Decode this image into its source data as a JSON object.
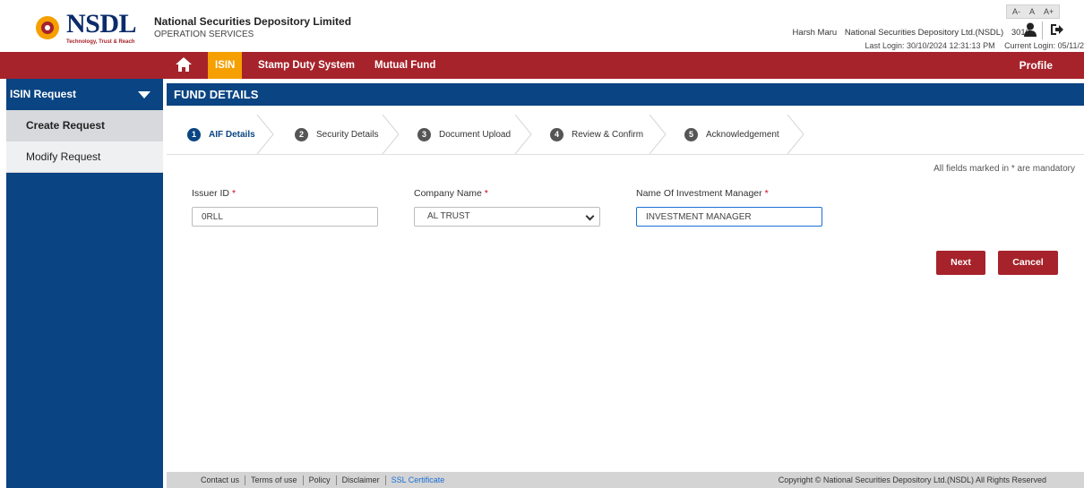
{
  "header": {
    "logo_name": "NSDL",
    "logo_tagline": "Technology, Trust & Reach",
    "org_title": "National Securities Depository Limited",
    "org_subtitle": "OPERATION SERVICES",
    "font_controls": [
      "A-",
      "A",
      "A+"
    ],
    "user_name": "Harsh Maru",
    "user_org": "National Securities Depository Ltd.(NSDL)",
    "user_code": "3010",
    "last_login": "Last Login: 30/10/2024  12:31:13 PM",
    "current_login": "Current Login: 05/11/2"
  },
  "nav": {
    "items": [
      "ISIN",
      "Stamp Duty System",
      "Mutual Fund"
    ],
    "active": "ISIN",
    "profile": "Profile"
  },
  "sidebar": {
    "title": "ISIN Request",
    "items": [
      {
        "label": "Create Request",
        "active": true
      },
      {
        "label": "Modify Request",
        "active": false
      }
    ]
  },
  "main": {
    "section_title": "FUND DETAILS",
    "steps": [
      {
        "num": "1",
        "label": "AIF Details",
        "active": true
      },
      {
        "num": "2",
        "label": "Security Details",
        "active": false
      },
      {
        "num": "3",
        "label": "Document Upload",
        "active": false
      },
      {
        "num": "4",
        "label": "Review & Confirm",
        "active": false
      },
      {
        "num": "5",
        "label": "Acknowledgement",
        "active": false
      }
    ],
    "mandatory_note": "All fields marked in * are mandatory",
    "fields": {
      "issuer_id": {
        "label": "Issuer ID",
        "value": "0RLL"
      },
      "company_name": {
        "label": "Company Name",
        "value": "AL TRUST"
      },
      "investment_manager": {
        "label": "Name Of Investment Manager",
        "value": "INVESTMENT MANAGER"
      }
    },
    "required_marker": "*",
    "buttons": {
      "next": "Next",
      "cancel": "Cancel"
    }
  },
  "footer": {
    "links": [
      "Contact us",
      "Terms of use",
      "Policy",
      "Disclaimer",
      "SSL Certificate"
    ],
    "copyright": "Copyright © National Securities Depository Ltd.(NSDL) All Rights Reserved"
  },
  "colors": {
    "brand_red": "#a6232b",
    "brand_blue": "#0a4482",
    "active_nav": "#f5a000"
  }
}
